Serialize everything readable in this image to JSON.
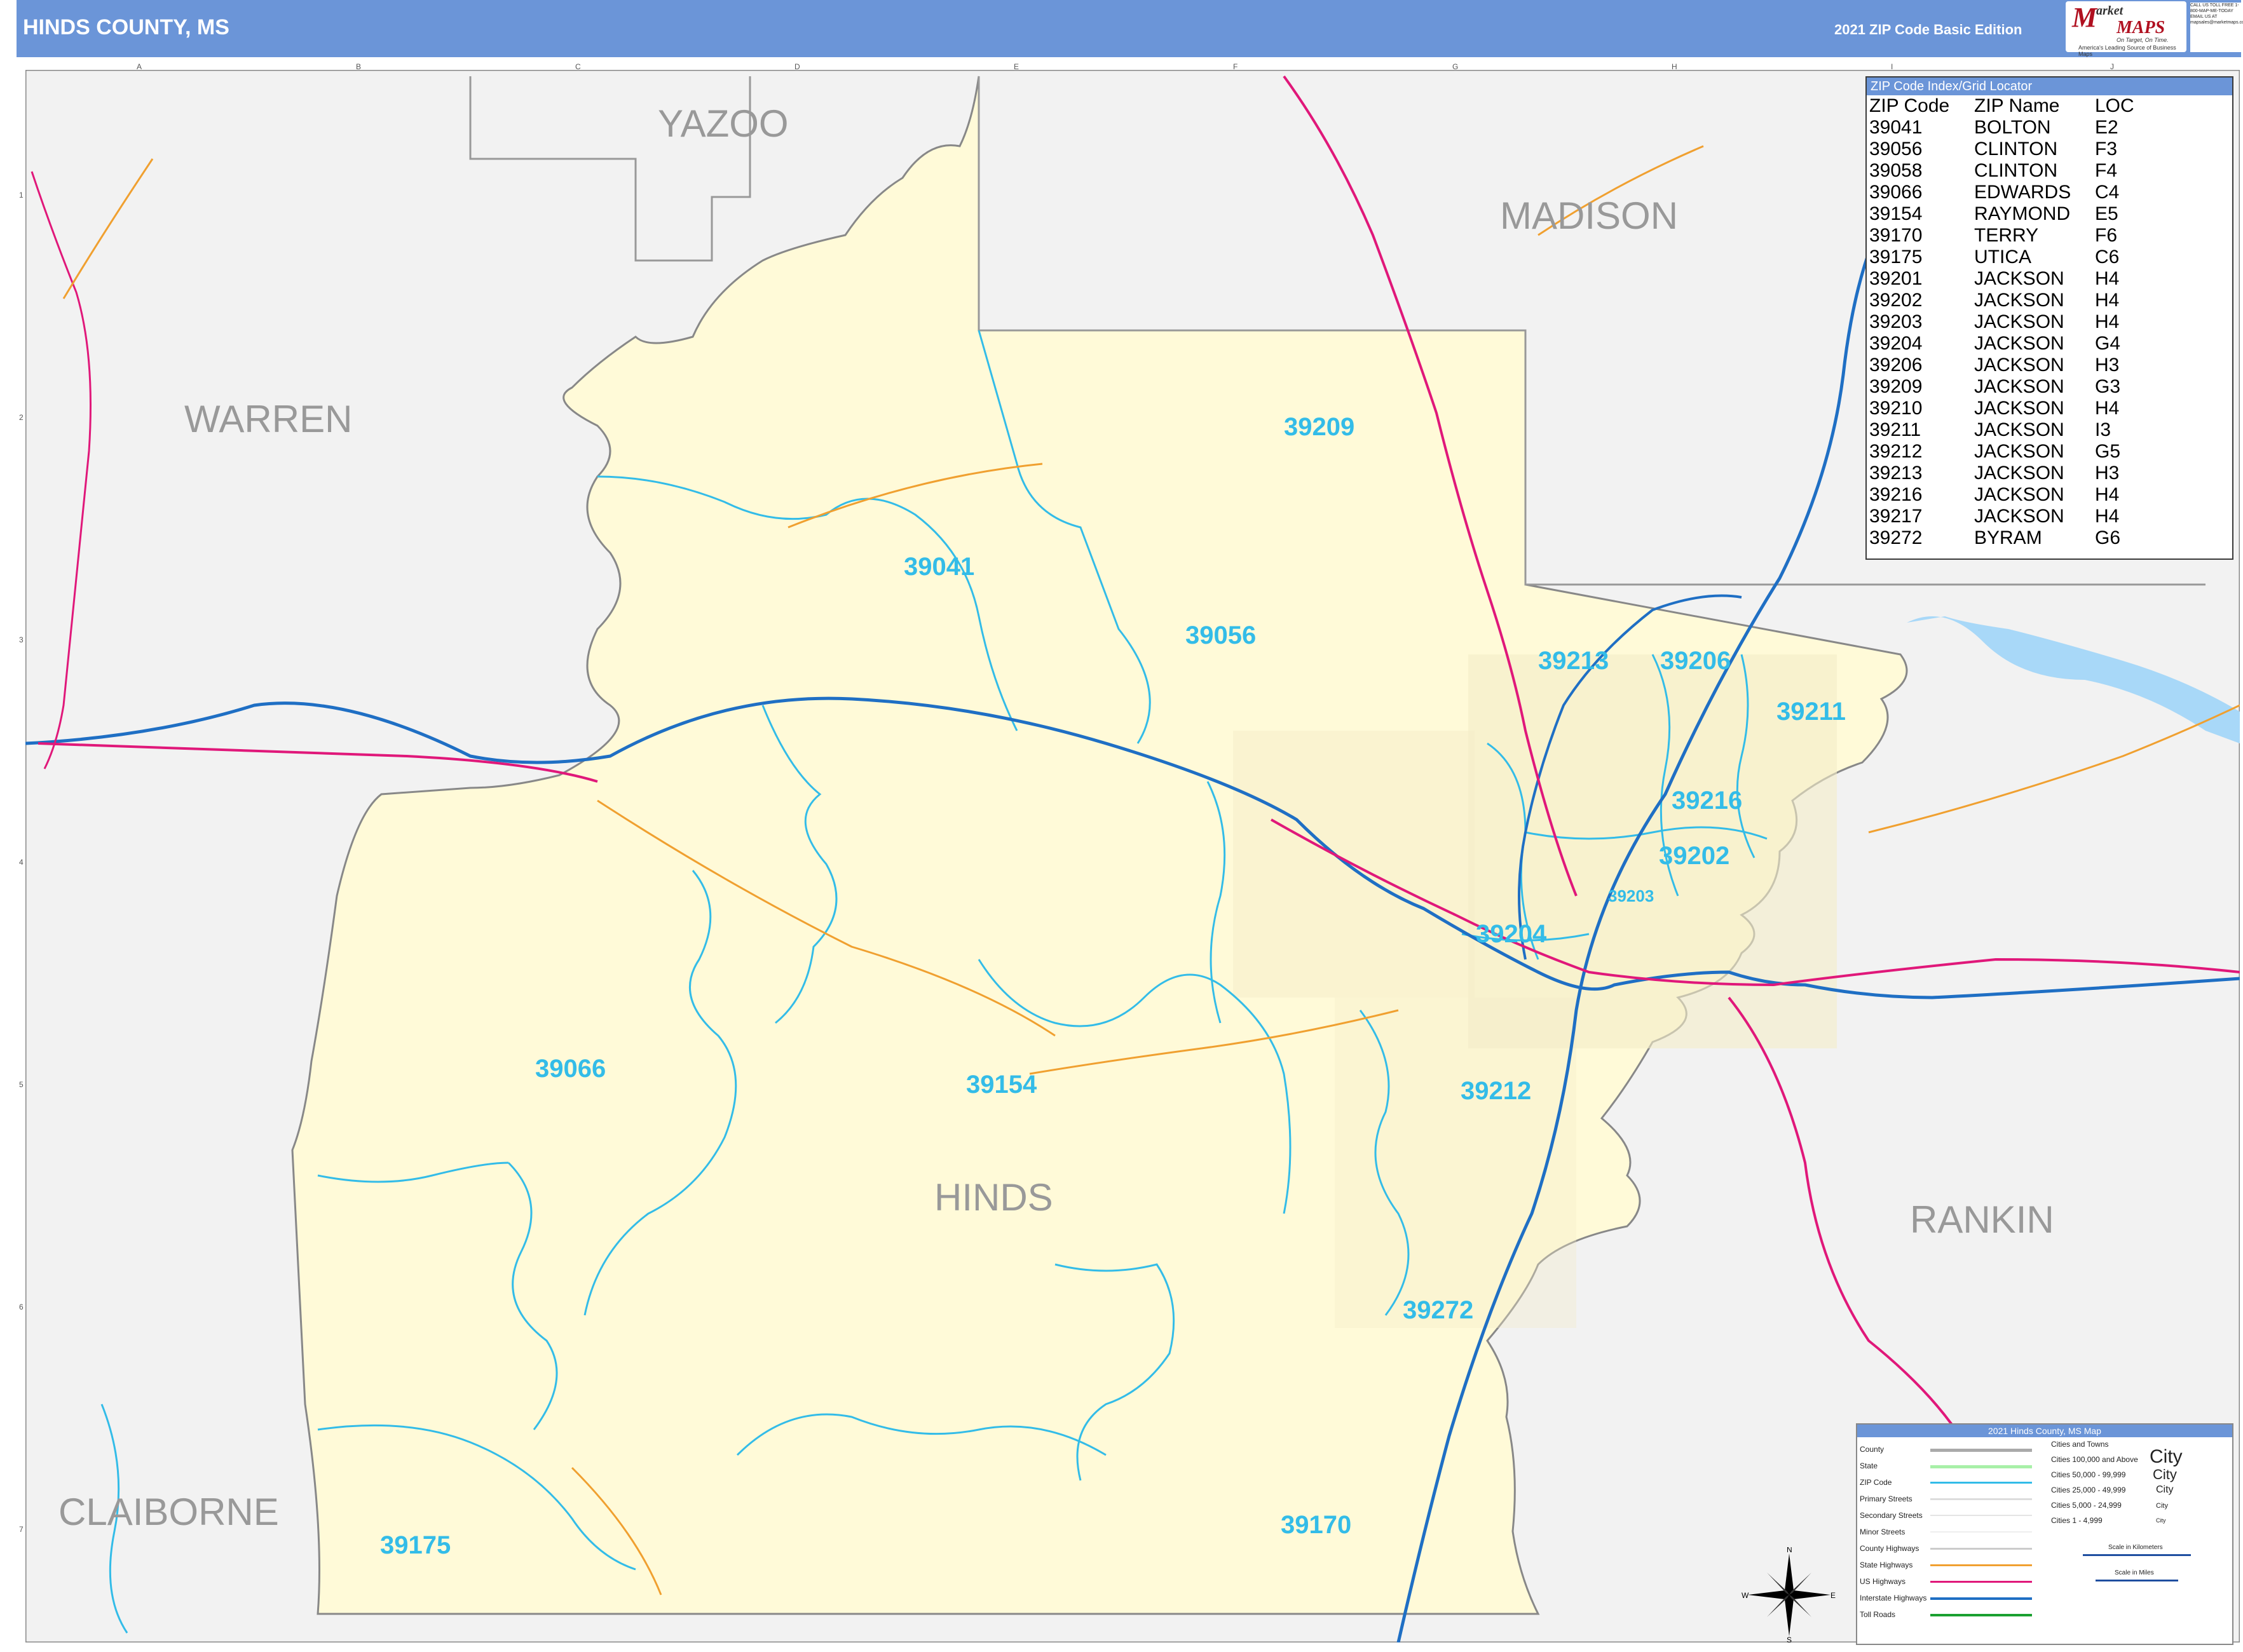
{
  "header": {
    "title": "HINDS COUNTY, MS",
    "edition": "2021 ZIP Code Basic Edition",
    "logo_m": "M",
    "logo_arket": "arket",
    "logo_maps": "MAPS",
    "logo_tagline": "On Target, On Time.",
    "logo_tagline2": "America's Leading Source of Business Maps",
    "contact": "CALL US TOLL FREE 1-800-MAP-ME-TODAY EMAIL US AT mapsales@marketmaps.com"
  },
  "colors": {
    "header_bg": "#6b95d8",
    "land_surrounding": "#f2f2f2",
    "hinds_county_fill": "#fffad8",
    "zip_boundary": "#33bce8",
    "interstate": "#1f6fc4",
    "us_highway": "#e0187a",
    "state_highway": "#f0a030",
    "water": "#a8d8f8"
  },
  "counties": {
    "yazoo": "YAZOO",
    "madison": "MADISON",
    "warren": "WARREN",
    "hinds": "HINDS",
    "rankin": "RANKIN",
    "claiborne": "CLAIBORNE"
  },
  "zip_labels": {
    "z39209": "39209",
    "z39041": "39041",
    "z39056": "39056",
    "z39213": "39213",
    "z39206": "39206",
    "z39211": "39211",
    "z39216": "39216",
    "z39202": "39202",
    "z39203": "39203",
    "z39204": "39204",
    "z39066": "39066",
    "z39154": "39154",
    "z39212": "39212",
    "z39272": "39272",
    "z39170": "39170",
    "z39175": "39175"
  },
  "zip_index": {
    "title": "ZIP Code Index/Grid Locator",
    "columns": [
      "ZIP Code",
      "ZIP Name",
      "LOC"
    ],
    "rows": [
      [
        "39041",
        "BOLTON",
        "E2"
      ],
      [
        "39056",
        "CLINTON",
        "F3"
      ],
      [
        "39058",
        "CLINTON",
        "F4"
      ],
      [
        "39066",
        "EDWARDS",
        "C4"
      ],
      [
        "39154",
        "RAYMOND",
        "E5"
      ],
      [
        "39170",
        "TERRY",
        "F6"
      ],
      [
        "39175",
        "UTICA",
        "C6"
      ],
      [
        "39201",
        "JACKSON",
        "H4"
      ],
      [
        "39202",
        "JACKSON",
        "H4"
      ],
      [
        "39203",
        "JACKSON",
        "H4"
      ],
      [
        "39204",
        "JACKSON",
        "G4"
      ],
      [
        "39206",
        "JACKSON",
        "H3"
      ],
      [
        "39209",
        "JACKSON",
        "G3"
      ],
      [
        "39210",
        "JACKSON",
        "H4"
      ],
      [
        "39211",
        "JACKSON",
        "I3"
      ],
      [
        "39212",
        "JACKSON",
        "G5"
      ],
      [
        "39213",
        "JACKSON",
        "H3"
      ],
      [
        "39216",
        "JACKSON",
        "H4"
      ],
      [
        "39217",
        "JACKSON",
        "H4"
      ],
      [
        "39272",
        "BYRAM",
        "G6"
      ]
    ]
  },
  "legend": {
    "title": "2021 Hinds County, MS Map",
    "items": [
      "County",
      "State",
      "ZIP Code",
      "Primary Streets",
      "Secondary Streets",
      "Minor Streets",
      "County Highways",
      "State Highways",
      "US Highways",
      "Interstate Highways",
      "Toll Roads"
    ],
    "cities_header": "Cities and Towns",
    "cities": [
      "Cities 100,000 and Above",
      "Cities 50,000 - 99,999",
      "Cities 25,000 - 49,999",
      "Cities 5,000 - 24,999",
      "Cities 1 - 4,999"
    ],
    "city_samples": [
      "City",
      "City",
      "City",
      "City",
      "City"
    ],
    "scale_km": "Scale in Kilometers",
    "scale_mi": "Scale in Miles"
  },
  "compass": {
    "n": "N",
    "s": "S",
    "e": "E",
    "w": "W"
  },
  "grid": {
    "cols": [
      "A",
      "B",
      "C",
      "D",
      "E",
      "F",
      "G",
      "H",
      "I",
      "J"
    ],
    "rows": [
      "1",
      "2",
      "3",
      "4",
      "5",
      "6",
      "7"
    ]
  }
}
